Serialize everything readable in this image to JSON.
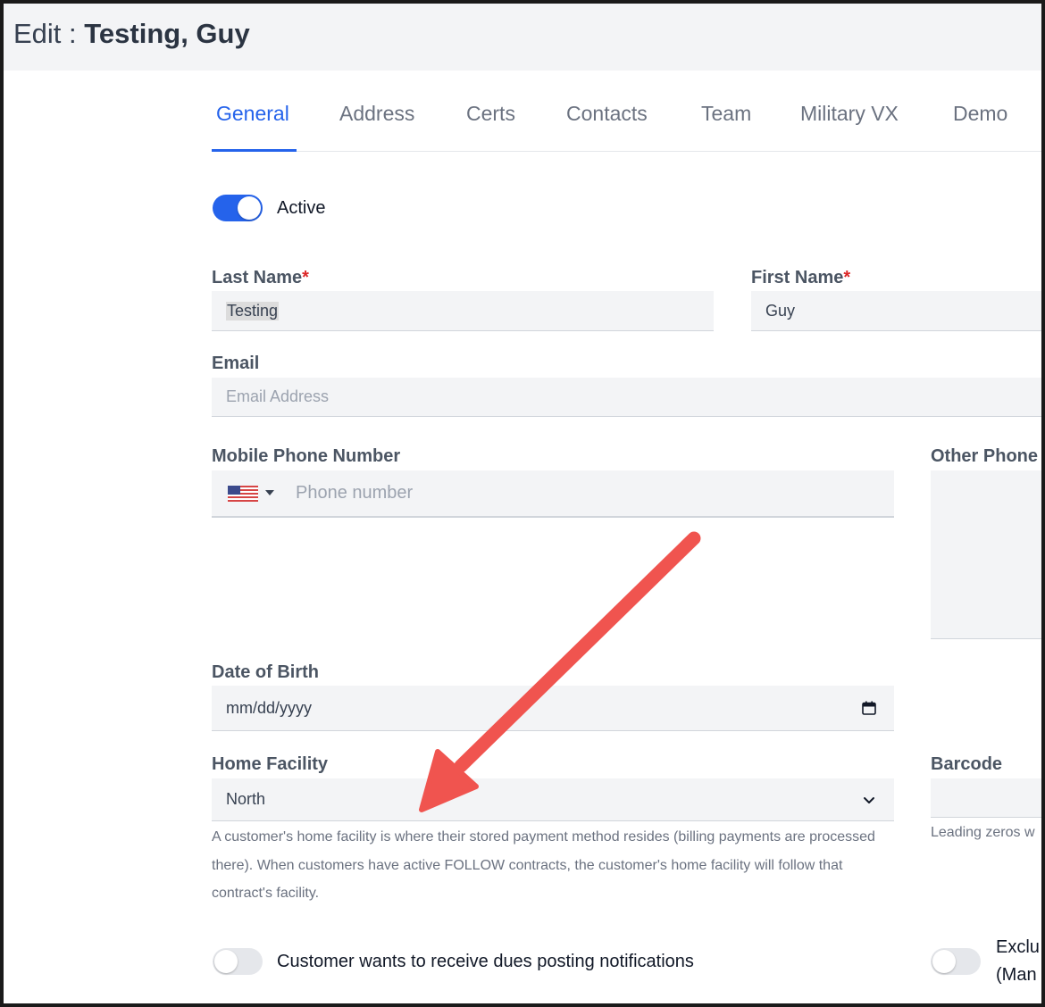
{
  "header": {
    "prefix": "Edit : ",
    "name": "Testing, Guy"
  },
  "tabs": [
    {
      "label": "General",
      "active": true
    },
    {
      "label": "Address"
    },
    {
      "label": "Certs"
    },
    {
      "label": "Contacts"
    },
    {
      "label": "Team"
    },
    {
      "label": "Military VX"
    },
    {
      "label": "Demo"
    }
  ],
  "active_toggle": {
    "label": "Active",
    "on": true
  },
  "last_name": {
    "label": "Last Name",
    "required_mark": "*",
    "value": "Testing"
  },
  "first_name": {
    "label": "First Name",
    "required_mark": "*",
    "value": "Guy"
  },
  "email": {
    "label": "Email",
    "placeholder": "Email Address"
  },
  "mobile_phone": {
    "label": "Mobile Phone Number",
    "country_icon": "us-flag-icon",
    "placeholder": "Phone number"
  },
  "other_phone": {
    "label": "Other Phone"
  },
  "dob": {
    "label": "Date of Birth",
    "placeholder": "mm/dd/yyyy"
  },
  "home_facility": {
    "label": "Home Facility",
    "value": "North",
    "help": "A customer's home facility is where their stored payment method resides (billing payments are processed there). When customers have active FOLLOW contracts, the customer's home facility will follow that contract's facility."
  },
  "barcode": {
    "label": "Barcode",
    "help": "Leading zeros w"
  },
  "dues_toggle": {
    "label": "Customer wants to receive dues posting notifications",
    "on": false
  },
  "exclude_toggle": {
    "line1": "Exclu",
    "line2": "(Man",
    "on": false
  },
  "colors": {
    "accent": "#2563eb",
    "required": "#dc2626",
    "arrow": "#f0544f"
  }
}
